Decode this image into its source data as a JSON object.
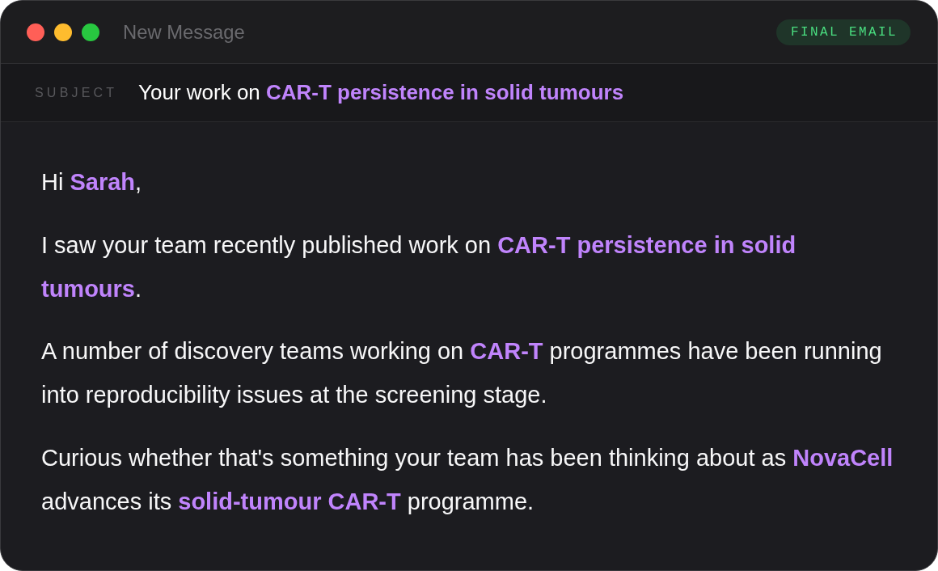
{
  "window": {
    "title": "New Message",
    "badge": "FINAL EMAIL"
  },
  "subject": {
    "label": "SUBJECT",
    "text": "Your work on **CAR-T persistence in solid tumours**"
  },
  "body": {
    "greeting": "Hi **Sarah**,",
    "paragraphs": [
      "I saw your team recently published work on **CAR-T persistence in solid tumours**.",
      "A number of discovery teams working on **CAR-T** programmes have been running into reproducibility issues at the screening stage.",
      "Curious whether that's something your team has been thinking about as **NovaCell** advances its **solid-tumour CAR-T** programme."
    ]
  }
}
